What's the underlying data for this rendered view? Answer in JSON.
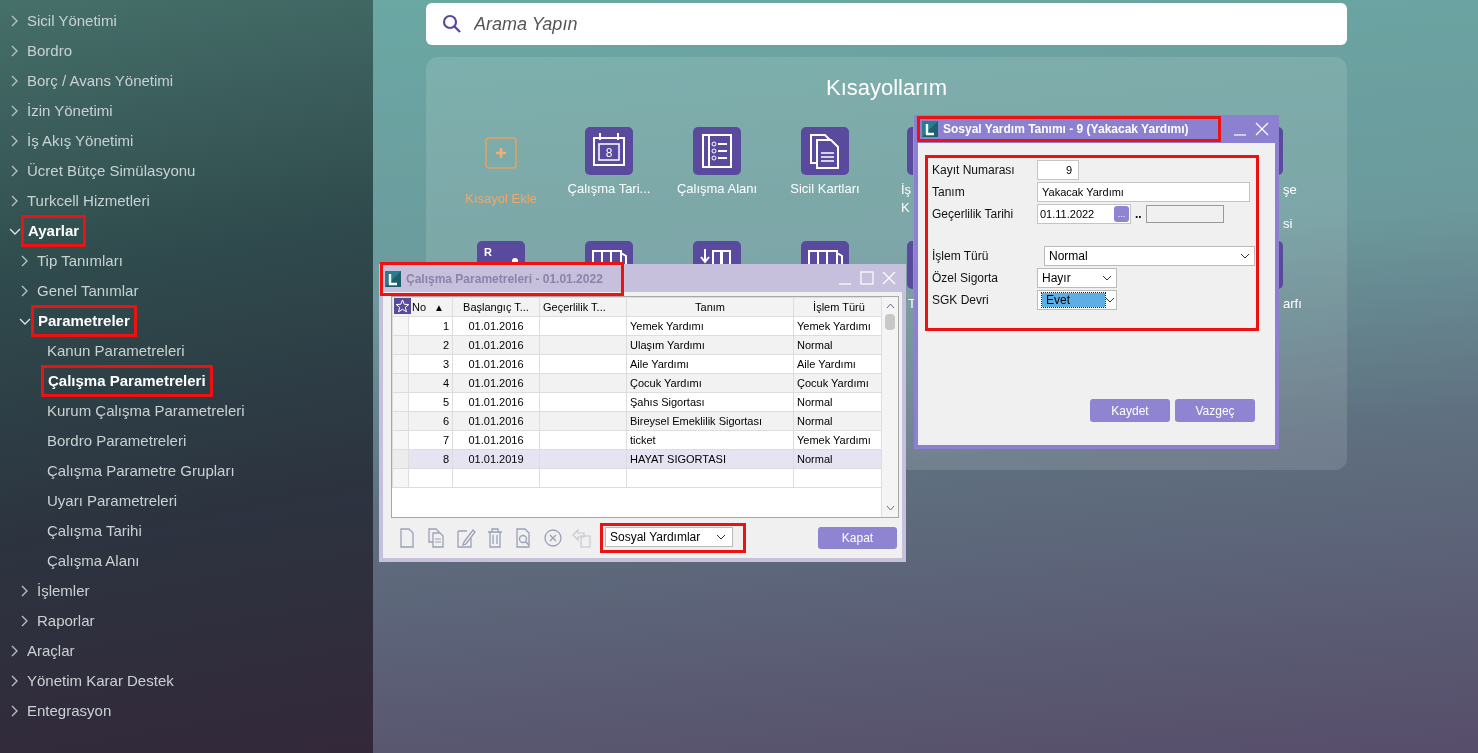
{
  "sidebar": {
    "items": [
      {
        "label": "Sicil Yönetimi",
        "expanded": false
      },
      {
        "label": "Bordro",
        "expanded": false
      },
      {
        "label": "Borç / Avans Yönetimi",
        "expanded": false
      },
      {
        "label": "İzin Yönetimi",
        "expanded": false
      },
      {
        "label": "İş Akış Yönetimi",
        "expanded": false
      },
      {
        "label": "Ücret Bütçe Simülasyonu",
        "expanded": false
      },
      {
        "label": "Turkcell Hizmetleri",
        "expanded": false
      },
      {
        "label": "Ayarlar",
        "expanded": true,
        "highlighted": true,
        "children": [
          {
            "label": "Tip Tanımları",
            "expanded": false
          },
          {
            "label": "Genel Tanımlar",
            "expanded": false
          },
          {
            "label": "Parametreler",
            "expanded": true,
            "highlighted": true,
            "children": [
              {
                "label": "Kanun Parametreleri",
                "selected": false
              },
              {
                "label": "Çalışma Parametreleri",
                "selected": true,
                "highlighted": true
              },
              {
                "label": "Kurum Çalışma Parametreleri",
                "selected": false
              },
              {
                "label": "Bordro Parametreleri",
                "selected": false
              },
              {
                "label": "Çalışma Parametre Grupları",
                "selected": false
              },
              {
                "label": "Uyarı Parametreleri",
                "selected": false
              },
              {
                "label": "Çalışma Tarihi",
                "selected": false
              },
              {
                "label": "Çalışma Alanı",
                "selected": false
              }
            ]
          },
          {
            "label": "İşlemler",
            "expanded": false
          },
          {
            "label": "Raporlar",
            "expanded": false
          }
        ]
      },
      {
        "label": "Araçlar",
        "expanded": false
      },
      {
        "label": "Yönetim Karar Destek",
        "expanded": false
      },
      {
        "label": "Entegrasyon",
        "expanded": false
      }
    ]
  },
  "search": {
    "placeholder": "Arama Yapın"
  },
  "shortcuts": {
    "title": "Kısayollarım",
    "rows": [
      [
        {
          "kind": "add",
          "label": "Kısayol Ekle"
        },
        {
          "kind": "calendar",
          "label": "Çalışma Tari...",
          "icon_text": "8"
        },
        {
          "kind": "list",
          "label": "Çalışma Alanı"
        },
        {
          "kind": "documents",
          "label": "Sicil Kartları"
        },
        {
          "kind": "partial",
          "lines": [
            "İş",
            "K"
          ]
        }
      ],
      [
        {
          "kind": "report",
          "icon_text": "R"
        },
        {
          "kind": "columns"
        },
        {
          "kind": "import"
        },
        {
          "kind": "columns"
        },
        {
          "kind": "partial",
          "lines": [
            "T"
          ]
        }
      ]
    ],
    "right_edge": [
      {
        "lines": [
          "şe",
          "si"
        ]
      },
      {
        "lines": [
          "arfı"
        ]
      }
    ]
  },
  "windows": [
    {
      "kind": "grid",
      "title": "Çalışma Parametreleri - 01.01.2022",
      "active": false,
      "title_highlighted": true,
      "table": {
        "columns": [
          {
            "label": "No",
            "sort_mark": "▲"
          },
          {
            "label": "Başlangıç T..."
          },
          {
            "label": "Geçerlilik T..."
          },
          {
            "label": "Tanım"
          },
          {
            "label": "İşlem Türü"
          }
        ],
        "rows": [
          {
            "cells": [
              "1",
              "01.01.2016",
              null,
              "Yemek Yardımı",
              "Yemek Yardımı"
            ],
            "selected": false
          },
          {
            "cells": [
              "2",
              "01.01.2016",
              null,
              "Ulaşım Yardımı",
              "Normal"
            ],
            "selected": false
          },
          {
            "cells": [
              "3",
              "01.01.2016",
              null,
              "Aile Yardımı",
              "Aile Yardımı"
            ],
            "selected": false
          },
          {
            "cells": [
              "4",
              "01.01.2016",
              null,
              "Çocuk Yardımı",
              "Çocuk Yardımı"
            ],
            "selected": false
          },
          {
            "cells": [
              "5",
              "01.01.2016",
              null,
              "Şahıs Sigortası",
              "Normal"
            ],
            "selected": false
          },
          {
            "cells": [
              "6",
              "01.01.2016",
              null,
              "Bireysel Emeklilik Sigortası",
              "Normal"
            ],
            "selected": false
          },
          {
            "cells": [
              "7",
              "01.01.2016",
              null,
              "ticket",
              "Yemek Yardımı"
            ],
            "selected": false
          },
          {
            "cells": [
              "8",
              "01.01.2019",
              null,
              "HAYAT SIGORTASI",
              "Normal"
            ],
            "selected": true
          }
        ]
      },
      "toolbar": [
        {
          "kind": "new",
          "disabled": false
        },
        {
          "kind": "copy",
          "disabled": false
        },
        {
          "kind": "edit",
          "disabled": false
        },
        {
          "kind": "delete",
          "disabled": false
        },
        {
          "kind": "preview",
          "disabled": false
        },
        {
          "kind": "cancel",
          "disabled": false
        },
        {
          "kind": "transfer",
          "disabled": true
        }
      ],
      "filter": {
        "value": "Sosyal Yardımlar",
        "highlighted": true
      },
      "buttons": [
        "Kapat"
      ]
    },
    {
      "kind": "form",
      "title": "Sosyal Yardım Tanımı - 9 (Yakacak Yardımı)",
      "active": true,
      "title_highlighted": true,
      "form_highlighted": true,
      "fields": [
        {
          "kind": "number",
          "label": "Kayıt Numarası",
          "value": "9"
        },
        {
          "kind": "text",
          "label": "Tanım",
          "value": "Yakacak Yardımı"
        },
        {
          "kind": "date-range",
          "label": "Geçerlilik Tarihi",
          "value": "01.11.2022",
          "picker": "...",
          "separator": ".."
        },
        {
          "kind": "wide-select",
          "label": "İşlem Türü",
          "value": "Normal",
          "focused": false
        },
        {
          "kind": "select",
          "label": "Özel Sigorta",
          "value": "Hayır",
          "focused": false
        },
        {
          "kind": "select",
          "label": "SGK Devri",
          "value": "Evet",
          "focused": true
        }
      ],
      "buttons": [
        "Kaydet",
        "Vazgeç"
      ]
    }
  ]
}
